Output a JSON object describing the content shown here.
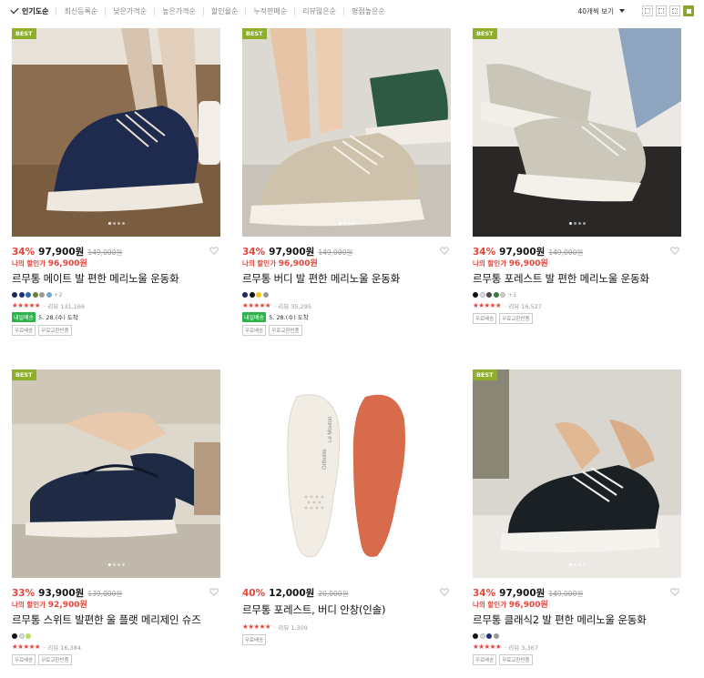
{
  "sort": {
    "items": [
      "인기도순",
      "최신등록순",
      "낮은가격순",
      "높은가격순",
      "할인율순",
      "누적판매순",
      "리뷰많은순",
      "평점높은순"
    ],
    "per_page": "40개씩 보기"
  },
  "colors": {
    "accent": "#8fae2c",
    "sale": "#e4463b",
    "ship": "#2bb34a"
  },
  "products": [
    {
      "badge": "BEST",
      "discount": "34%",
      "price": "97,900원",
      "original": "149,000원",
      "my_label": "나의 할인가",
      "my_price": "96,900원",
      "name": "르무통 메이트 발 편한 메리노울 운동화",
      "swatches": [
        "#1c2a55",
        "#1f2f7a",
        "#2e6aa6",
        "#6a7f3a",
        "#9a9a9a",
        "#7aa6c8"
      ],
      "more": "+2",
      "stars": "★★★★★",
      "review": "· 리뷰 131,166",
      "ship_label": "내일배송",
      "ship_date": "5. 28.(수) 도착",
      "tags": [
        "무료배송",
        "무료교환반품"
      ],
      "image": "navy-sneaker"
    },
    {
      "badge": "BEST",
      "discount": "34%",
      "price": "97,900원",
      "original": "149,000원",
      "my_label": "나의 할인가",
      "my_price": "96,900원",
      "name": "르무통 버디 발 편한 메리노울 운동화",
      "swatches": [
        "#1c2a55",
        "#141414",
        "#f0c820",
        "#9a9a9a"
      ],
      "more": "",
      "stars": "★★★★★",
      "review": "· 리뷰 35,295",
      "ship_label": "내일배송",
      "ship_date": "5. 28.(수) 도착",
      "tags": [
        "무료배송",
        "무료교환반품"
      ],
      "image": "beige-sneaker"
    },
    {
      "badge": "BEST",
      "discount": "34%",
      "price": "97,900원",
      "original": "149,000원",
      "my_label": "나의 할인가",
      "my_price": "96,900원",
      "name": "르무통 포레스트 발 편한 메리노울 운동화",
      "swatches": [
        "#141414",
        "#dcdcdc",
        "#4a4a4a",
        "#3a7a3a",
        "#cccccc"
      ],
      "more": "+1",
      "stars": "★★★★★",
      "review": "· 리뷰 16,527",
      "ship_label": "",
      "ship_date": "",
      "tags": [
        "무료배송",
        "무료교환반품"
      ],
      "image": "grey-sneaker"
    },
    {
      "badge": "BEST",
      "discount": "33%",
      "price": "93,900원",
      "original": "139,000원",
      "my_label": "나의 할인가",
      "my_price": "92,900원",
      "name": "르무통 스위트 발편한 울 플랫 메리제인 슈즈",
      "swatches": [
        "#141414",
        "#dcdcdc",
        "#b8e060"
      ],
      "more": "",
      "stars": "★★★★★",
      "review": "· 리뷰 16,384",
      "ship_label": "",
      "ship_date": "",
      "tags": [
        "무료배송",
        "무료교환반품"
      ],
      "image": "maryjane"
    },
    {
      "badge": "",
      "discount": "40%",
      "price": "12,000원",
      "original": "20,000원",
      "my_label": "",
      "my_price": "",
      "name": "르무통 포레스트, 버디 안창(인솔)",
      "swatches": [],
      "more": "",
      "stars": "★★★★★",
      "review": "· 리뷰 1,309",
      "ship_label": "",
      "ship_date": "",
      "tags": [
        "무료배송"
      ],
      "image": "insole",
      "insole_text": [
        "Ortholite",
        "Le Mouton"
      ]
    },
    {
      "badge": "BEST",
      "discount": "34%",
      "price": "97,900원",
      "original": "149,000원",
      "my_label": "나의 할인가",
      "my_price": "96,900원",
      "name": "르무통 클래식2 발 편한 메리노울 운동화",
      "swatches": [
        "#141414",
        "#dcdcdc",
        "#1f2f7a",
        "#9a9a9a"
      ],
      "more": "",
      "stars": "★★★★★",
      "review": "· 리뷰 3,367",
      "ship_label": "",
      "ship_date": "",
      "tags": [
        "무료배송",
        "무료교환반품"
      ],
      "image": "black-sneaker"
    }
  ]
}
